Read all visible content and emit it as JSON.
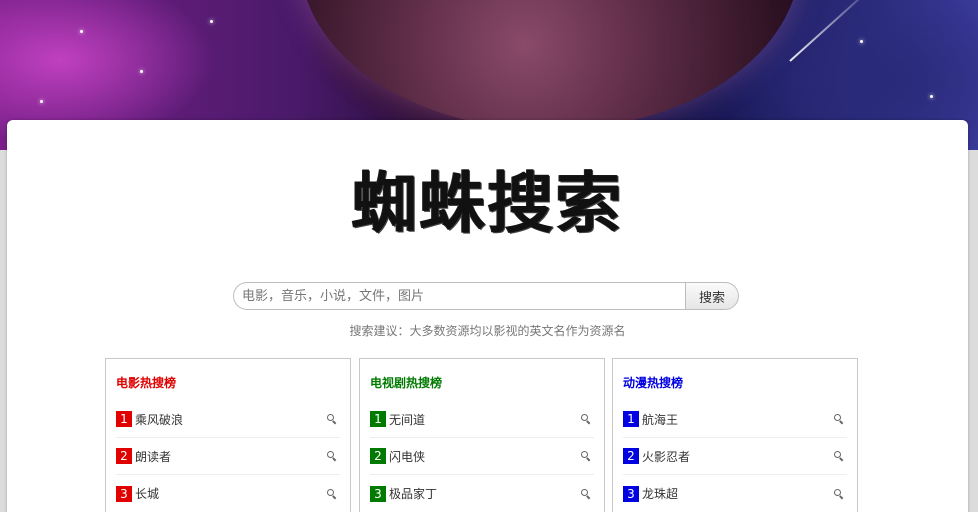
{
  "logo": "蜘蛛搜索",
  "search": {
    "placeholder": "电影，音乐，小说，文件，图片",
    "button_label": "搜索",
    "hint": "搜索建议：大多数资源均以影视的英文名作为资源名"
  },
  "colors": {
    "movie": "#e00000",
    "tv": "#007a00",
    "anime": "#0000e0"
  },
  "panels": [
    {
      "title": "电影热搜榜",
      "color": "#e00000",
      "items": [
        {
          "rank": "1",
          "name": "乘风破浪"
        },
        {
          "rank": "2",
          "name": "朗读者"
        },
        {
          "rank": "3",
          "name": "长城"
        }
      ]
    },
    {
      "title": "电视剧热搜榜",
      "color": "#007a00",
      "items": [
        {
          "rank": "1",
          "name": "无间道"
        },
        {
          "rank": "2",
          "name": "闪电侠"
        },
        {
          "rank": "3",
          "name": "极品家丁"
        }
      ]
    },
    {
      "title": "动漫热搜榜",
      "color": "#0000e0",
      "items": [
        {
          "rank": "1",
          "name": "航海王"
        },
        {
          "rank": "2",
          "name": "火影忍者"
        },
        {
          "rank": "3",
          "name": "龙珠超"
        }
      ]
    }
  ]
}
